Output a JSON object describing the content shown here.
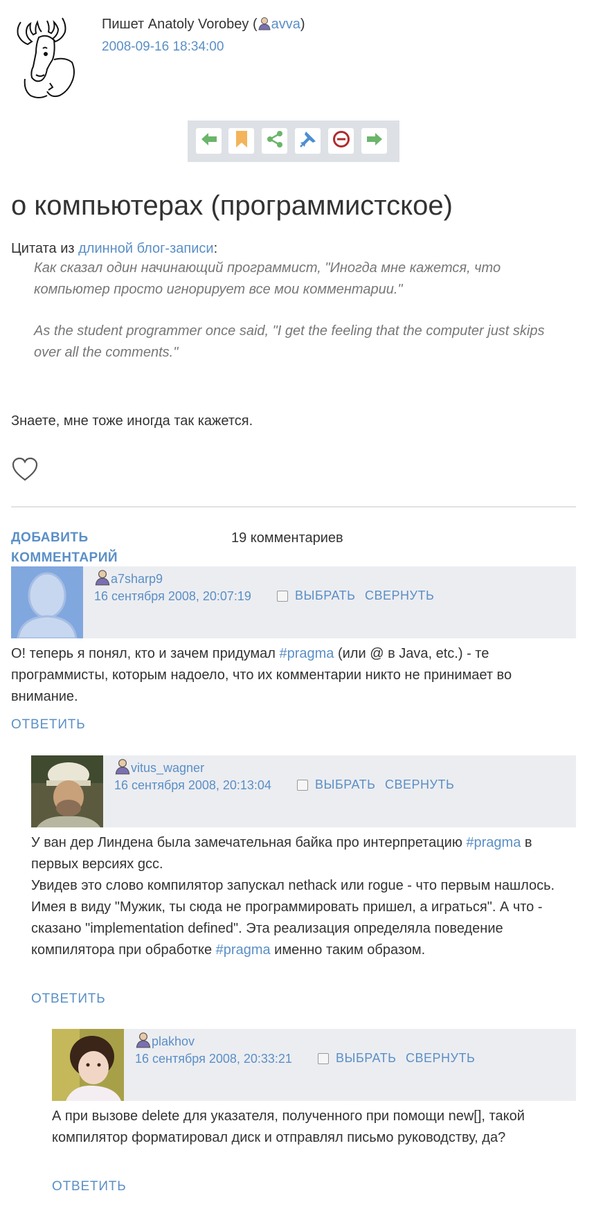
{
  "post": {
    "author_prefix": "Пишет Anatoly Vorobey (",
    "author_username": "avva",
    "author_suffix": ")",
    "date": "2008-09-16 18:34:00",
    "title": "о компьютерах (программистское)",
    "quote_intro_prefix": "Цитата из ",
    "quote_intro_link": "длинной блог-записи",
    "quote_intro_suffix": ":",
    "quote_ru": "Как сказал один начинающий программист, \"Иногда мне кажется, что компьютер просто игнорирует все мои комментарии.\"",
    "quote_en": "As the student programmer once said, \"I get the feeling that the computer just skips over all the comments.\"",
    "after_text": "Знаете, мне тоже иногда так кажется."
  },
  "toolbar": {
    "icons": [
      "prev-arrow-icon",
      "bookmark-icon",
      "share-icon",
      "pin-icon",
      "ignore-icon",
      "next-arrow-icon"
    ]
  },
  "comments_bar": {
    "add_label_line1": "ДОБАВИТЬ",
    "add_label_line2": "КОММЕНТАРИЙ",
    "count_label": "19 комментариев"
  },
  "comments": [
    {
      "username": "a7sharp9",
      "date": "16 сентября 2008, 20:07:19",
      "select_label": "ВЫБРАТЬ",
      "collapse_label": "СВЕРНУТЬ",
      "text_1": "О! теперь я понял, кто и зачем придумал ",
      "tag_1": "#pragma",
      "text_2": " (или @ в Java, etc.) - те программисты, которым надоело, что их комментарии никто не принимает во внимание.",
      "reply_label": "ОТВЕТИТЬ"
    },
    {
      "username": "vitus_wagner",
      "date": "16 сентября 2008, 20:13:04",
      "select_label": "ВЫБРАТЬ",
      "collapse_label": "СВЕРНУТЬ",
      "text_1": "У ван дер Линдена была замечательная байка про интерпретацию ",
      "tag_1": "#pragma",
      "text_2": " в первых версиях gcc.",
      "text_3": "Увидев это слово компилятор запускал nethack или rogue - что первым нашлось. Имея в виду \"Мужик, ты сюда не программировать пришел, а играться\". А что - сказано \"implementation defined\". Эта реализация определяла поведение компилятора при обработке ",
      "tag_2": "#pragma",
      "text_4": " именно таким образом.",
      "reply_label": "ОТВЕТИТЬ"
    },
    {
      "username": "plakhov",
      "date": "16 сентября 2008, 20:33:21",
      "select_label": "ВЫБРАТЬ",
      "collapse_label": "СВЕРНУТЬ",
      "text_1": "А при вызове delete для указателя, полученного при помощи new[], такой компилятор форматировал диск и отправлял письмо руководству, да?",
      "reply_label": "ОТВЕТИТЬ"
    }
  ]
}
